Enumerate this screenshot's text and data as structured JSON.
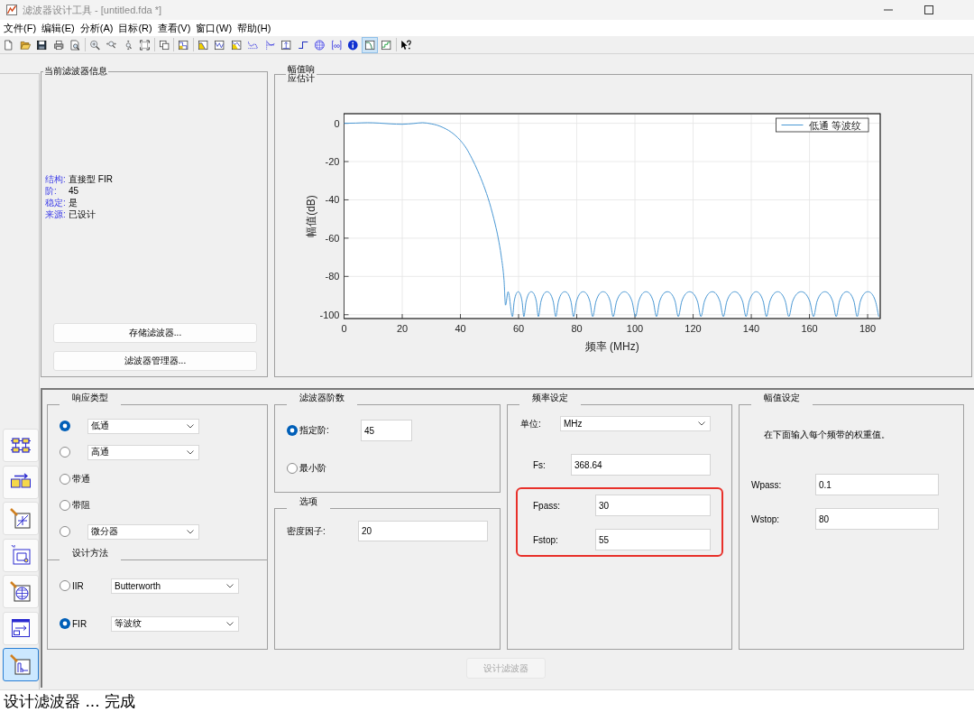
{
  "window": {
    "title": "滤波器设计工具 - [untitled.fda *]"
  },
  "menu": [
    "文件(F)",
    "编辑(E)",
    "分析(A)",
    "目标(R)",
    "查看(V)",
    "窗口(W)",
    "帮助(H)"
  ],
  "toolbar": {
    "groups": [
      [
        {
          "selected": false
        },
        {
          "selected": false
        },
        {
          "selected": false
        },
        {
          "selected": false
        },
        {
          "selected": false
        }
      ],
      [
        {
          "selected": false
        },
        {
          "selected": false
        },
        {
          "selected": false
        },
        {
          "selected": false
        }
      ],
      [
        {
          "selected": false
        }
      ],
      [
        {
          "selected": false
        }
      ],
      [
        {
          "selected": false
        },
        {
          "selected": false
        },
        {
          "selected": false
        },
        {
          "selected": false
        },
        {
          "selected": false
        },
        {
          "selected": false
        },
        {
          "selected": false
        },
        {
          "selected": false
        },
        {
          "selected": false
        },
        {
          "selected": false
        },
        {
          "selected": true
        },
        {
          "selected": false
        }
      ],
      [
        {
          "selected": false
        }
      ]
    ]
  },
  "side_buttons": [
    {
      "selected": false
    },
    {
      "selected": false
    },
    {
      "selected": false
    },
    {
      "selected": false
    },
    {
      "selected": false
    },
    {
      "selected": false
    },
    {
      "selected": true
    }
  ],
  "filter_info": {
    "title": "当前滤波器信息",
    "rows": [
      {
        "label": "结构:",
        "value": "直接型 FIR"
      },
      {
        "label": "阶:",
        "value": "45"
      },
      {
        "label": "稳定:",
        "value": "是"
      },
      {
        "label": "来源:",
        "value": "已设计"
      }
    ],
    "buttons": [
      "存储滤波器...",
      "滤波器管理器..."
    ]
  },
  "response_panel": {
    "title": "幅值响应估计",
    "chart_data": {
      "type": "line",
      "xlabel": "频率 (MHz)",
      "ylabel": "幅值(dB)",
      "x": [
        0,
        4,
        8,
        12,
        16,
        20,
        24,
        27,
        30,
        32,
        34,
        36,
        38,
        40,
        42,
        44,
        46,
        48,
        50,
        52,
        53,
        54,
        55,
        55.5,
        56.4,
        57.9,
        58.5,
        59.9,
        61.2,
        61.8,
        62.6,
        64.3,
        66.1,
        66.8,
        67.7,
        69.8,
        71.9,
        72.8,
        73.7,
        75.9,
        78.0,
        78.9,
        79.9,
        82.2,
        84.5,
        85.5,
        86.6,
        89.0,
        91.5,
        92.5,
        93.7,
        96.4,
        99.0,
        100.2,
        101.3,
        103.8,
        106.3,
        107.4,
        108.5,
        111.2,
        113.8,
        114.9,
        116.1,
        118.8,
        121.5,
        122.7,
        123.9,
        126.6,
        129.2,
        130.4,
        131.6,
        134.3,
        137.0,
        138.2,
        139.3,
        141.7,
        144.1,
        145.2,
        146.4,
        149.1,
        151.7,
        152.9,
        154.2,
        157.2,
        160.1,
        161.4,
        162.6,
        165.3,
        168.0,
        169.2,
        170.3,
        172.8,
        175.3,
        176.4,
        177.5,
        180.1,
        182.7,
        183.8
      ],
      "series": [
        {
          "name": "低通 等波纹",
          "color": "#4a98d4",
          "values": [
            0,
            0.1,
            0.3,
            0.1,
            -0.3,
            -0.5,
            -0.1,
            0.3,
            -0.3,
            -1,
            -2.2,
            -3.8,
            -6,
            -9,
            -13,
            -18.5,
            -25,
            -32.5,
            -41.5,
            -53,
            -60,
            -69,
            -82,
            -95,
            -88,
            -101,
            -93,
            -88,
            -93,
            -101,
            -93,
            -88,
            -93,
            -101,
            -93,
            -88,
            -93,
            -101,
            -93,
            -88,
            -93,
            -101,
            -93,
            -88,
            -93,
            -101,
            -93,
            -88,
            -93,
            -101,
            -93,
            -88,
            -93,
            -101,
            -93,
            -88,
            -93,
            -101,
            -93,
            -88,
            -93,
            -101,
            -93,
            -88,
            -93,
            -101,
            -93,
            -88,
            -93,
            -101,
            -93,
            -88,
            -93,
            -101,
            -93,
            -88,
            -93,
            -101,
            -93,
            -88,
            -93,
            -101,
            -93,
            -88,
            -93,
            -101,
            -93,
            -88,
            -93,
            -101,
            -93,
            -88,
            -93,
            -101,
            -93,
            -88,
            -93,
            -101
          ]
        }
      ],
      "xlim": [
        0,
        184.32
      ],
      "ylim": [
        -102,
        5
      ],
      "xticks": [
        0,
        20,
        40,
        60,
        80,
        100,
        120,
        140,
        160,
        180
      ],
      "yticks": [
        -100,
        -80,
        -60,
        -40,
        -20,
        0
      ],
      "grid": true
    }
  },
  "response_type": {
    "title": "响应类型",
    "options": [
      {
        "kind": "dropdown",
        "value": "低通",
        "selected": true
      },
      {
        "kind": "dropdown",
        "value": "高通",
        "selected": false
      },
      {
        "kind": "label",
        "label": "带通",
        "selected": false
      },
      {
        "kind": "label",
        "label": "带阻",
        "selected": false
      },
      {
        "kind": "dropdown",
        "value": "微分器",
        "selected": false
      }
    ]
  },
  "design_method": {
    "title": "设计方法",
    "options": [
      {
        "label": "IIR",
        "value": "Butterworth",
        "selected": false
      },
      {
        "label": "FIR",
        "value": "等波纹",
        "selected": true
      }
    ]
  },
  "filter_order": {
    "title": "滤波器阶数",
    "options": [
      {
        "kind": "input",
        "label": "指定阶:",
        "value": "45",
        "selected": true
      },
      {
        "kind": "plain",
        "label": "最小阶",
        "selected": false
      }
    ]
  },
  "options": {
    "title": "选项",
    "fields": [
      {
        "label": "密度因子:",
        "value": "20"
      }
    ]
  },
  "frequency": {
    "title": "频率设定",
    "unit": {
      "label": "单位:",
      "value": "MHz"
    },
    "fields": [
      {
        "label": "Fs:",
        "value": "368.64",
        "highlighted": false
      },
      {
        "label": "Fpass:",
        "value": "30",
        "highlighted": true
      },
      {
        "label": "Fstop:",
        "value": "55",
        "highlighted": true
      }
    ]
  },
  "magnitude": {
    "title": "幅值设定",
    "note": "在下面输入每个频带的权重值。",
    "fields": [
      {
        "label": "Wpass:",
        "value": "0.1"
      },
      {
        "label": "Wstop:",
        "value": "80"
      }
    ]
  },
  "design_button": {
    "label": "设计滤波器",
    "disabled": true
  },
  "status_bar": {
    "text": "设计滤波器 ... 完成"
  }
}
